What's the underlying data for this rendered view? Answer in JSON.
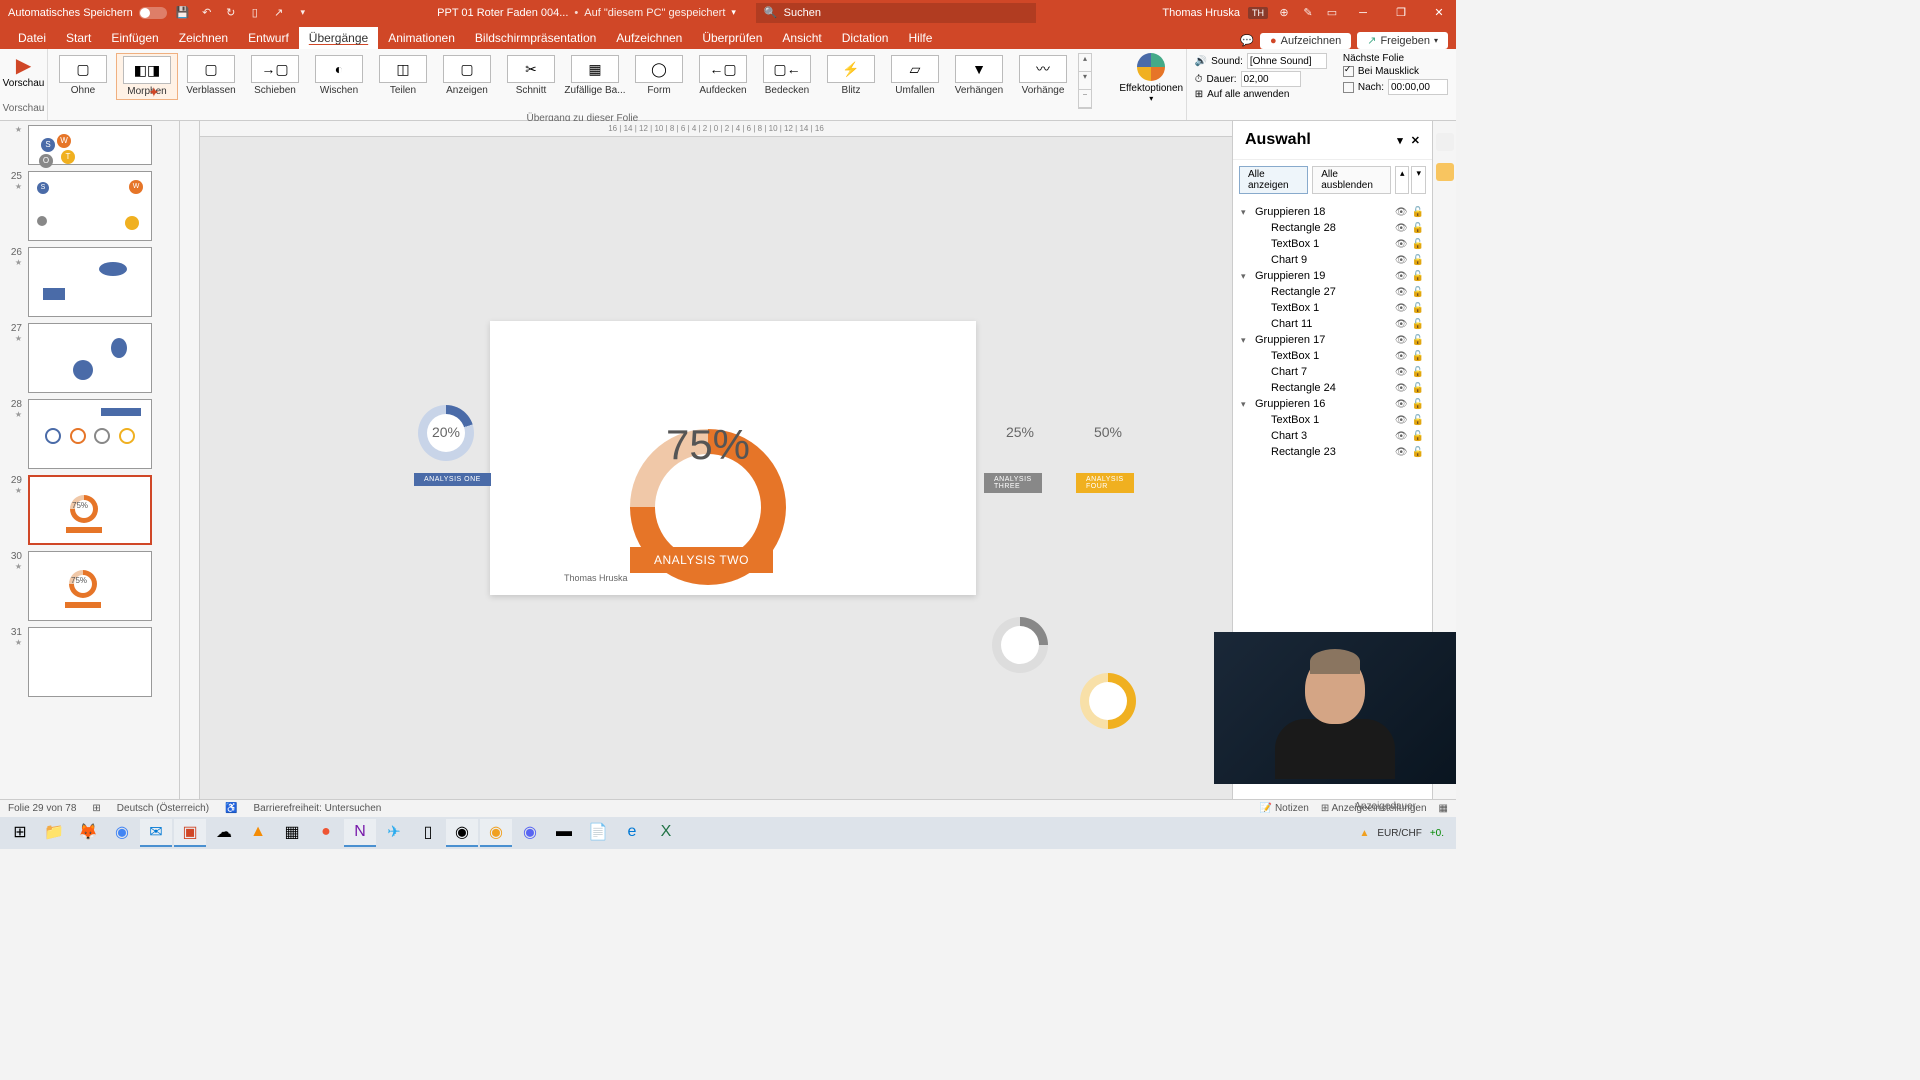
{
  "titlebar": {
    "autosave": "Automatisches Speichern",
    "doc": "PPT 01 Roter Faden 004...",
    "saved": "Auf \"diesem PC\" gespeichert",
    "search": "Suchen",
    "user": "Thomas Hruska",
    "badge": "TH"
  },
  "tabs": {
    "datei": "Datei",
    "start": "Start",
    "einfuegen": "Einfügen",
    "zeichnen": "Zeichnen",
    "entwurf": "Entwurf",
    "uebergaenge": "Übergänge",
    "animationen": "Animationen",
    "bildschirm": "Bildschirmpräsentation",
    "aufzeichnen": "Aufzeichnen",
    "ueberpruefen": "Überprüfen",
    "ansicht": "Ansicht",
    "dictation": "Dictation",
    "hilfe": "Hilfe"
  },
  "ribbon_right": {
    "aufzeichnen": "Aufzeichnen",
    "freigeben": "Freigeben"
  },
  "ribbon": {
    "vorschau": "Vorschau",
    "transitions": [
      {
        "label": "Ohne"
      },
      {
        "label": "Morphen"
      },
      {
        "label": "Verblassen"
      },
      {
        "label": "Schieben"
      },
      {
        "label": "Wischen"
      },
      {
        "label": "Teilen"
      },
      {
        "label": "Anzeigen"
      },
      {
        "label": "Schnitt"
      },
      {
        "label": "Zufällige Ba..."
      },
      {
        "label": "Form"
      },
      {
        "label": "Aufdecken"
      },
      {
        "label": "Bedecken"
      },
      {
        "label": "Blitz"
      },
      {
        "label": "Umfallen"
      },
      {
        "label": "Verhängen"
      },
      {
        "label": "Vorhänge"
      }
    ],
    "effekt": "Effektoptionen",
    "group_caption": "Übergang zu dieser Folie",
    "sound_lbl": "Sound:",
    "sound_val": "[Ohne Sound]",
    "dauer_lbl": "Dauer:",
    "dauer_val": "02,00",
    "apply_all": "Auf alle anwenden",
    "next_slide": "Nächste Folie",
    "on_click": "Bei Mausklick",
    "after": "Nach:",
    "after_val": "00:00,00",
    "anzeigedauer": "Anzeigedauer"
  },
  "slides": [
    {
      "num": ""
    },
    {
      "num": "25"
    },
    {
      "num": "26"
    },
    {
      "num": "27"
    },
    {
      "num": "28"
    },
    {
      "num": "29"
    },
    {
      "num": "30"
    },
    {
      "num": "31"
    }
  ],
  "chart_data": {
    "type": "pie",
    "series": [
      {
        "name": "ANALYSIS ONE",
        "value": 20,
        "color": "#4a6ba8"
      },
      {
        "name": "ANALYSIS TWO",
        "value": 75,
        "color": "#e67528"
      },
      {
        "name": "ANALYSIS THREE",
        "value": 25,
        "color": "#888888"
      },
      {
        "name": "ANALYSIS FOUR",
        "value": 50,
        "color": "#f0b020"
      }
    ],
    "display": {
      "pct20": "20%",
      "pct75": "75%",
      "pct25": "25%",
      "pct50": "50%",
      "lbl1": "ANALYSIS ONE",
      "lbl2": "ANALYSIS TWO",
      "lbl3": "ANALYSIS THREE",
      "lbl4": "ANALYSIS FOUR"
    },
    "author": "Thomas Hruska"
  },
  "selection": {
    "title": "Auswahl",
    "show_all": "Alle anzeigen",
    "hide_all": "Alle ausblenden",
    "items": [
      {
        "label": "Gruppieren 18",
        "group": true
      },
      {
        "label": "Rectangle 28"
      },
      {
        "label": "TextBox 1"
      },
      {
        "label": "Chart 9"
      },
      {
        "label": "Gruppieren 19",
        "group": true
      },
      {
        "label": "Rectangle 27"
      },
      {
        "label": "TextBox 1"
      },
      {
        "label": "Chart 11"
      },
      {
        "label": "Gruppieren 17",
        "group": true
      },
      {
        "label": "TextBox 1"
      },
      {
        "label": "Chart 7"
      },
      {
        "label": "Rectangle 24"
      },
      {
        "label": "Gruppieren 16",
        "group": true
      },
      {
        "label": "TextBox 1"
      },
      {
        "label": "Chart 3"
      },
      {
        "label": "Rectangle 23"
      }
    ]
  },
  "status": {
    "slide": "Folie 29 von 78",
    "lang": "Deutsch (Österreich)",
    "access": "Barrierefreiheit: Untersuchen",
    "notizen": "Notizen",
    "display": "Anzeigeeinstellungen"
  },
  "taskbar": {
    "fx": "EUR/CHF",
    "fx_val": "+0."
  },
  "thumb": {
    "pct75": "75%"
  }
}
